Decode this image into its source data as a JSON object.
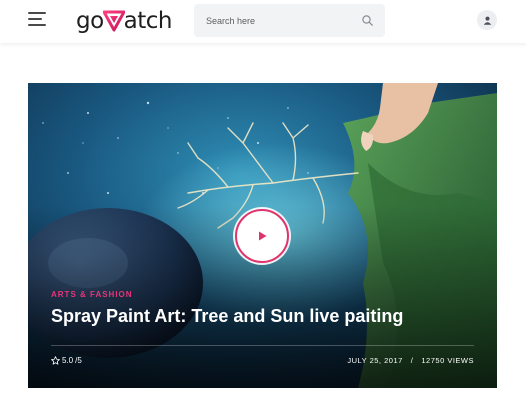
{
  "header": {
    "logo_text_before": "go",
    "logo_text_after": "atch",
    "logo_icon": "play-triangle-icon",
    "search_placeholder": "Search here",
    "search_icon": "search-icon",
    "user_icon": "user-icon",
    "menu_icon": "hamburger-menu-icon"
  },
  "featured": {
    "category": "ARTS & FASHION",
    "title": "Spray Paint Art: Tree and Sun live paiting",
    "rating": "5.0",
    "rating_max": "/5",
    "date": "JULY 25, 2017",
    "separator": "/",
    "views": "12750 VIEWS",
    "play_icon": "play-icon",
    "star_icon": "star-icon"
  },
  "colors": {
    "accent": "#e0336b",
    "category": "#e8357a",
    "search_bg": "#f2f3f5"
  }
}
